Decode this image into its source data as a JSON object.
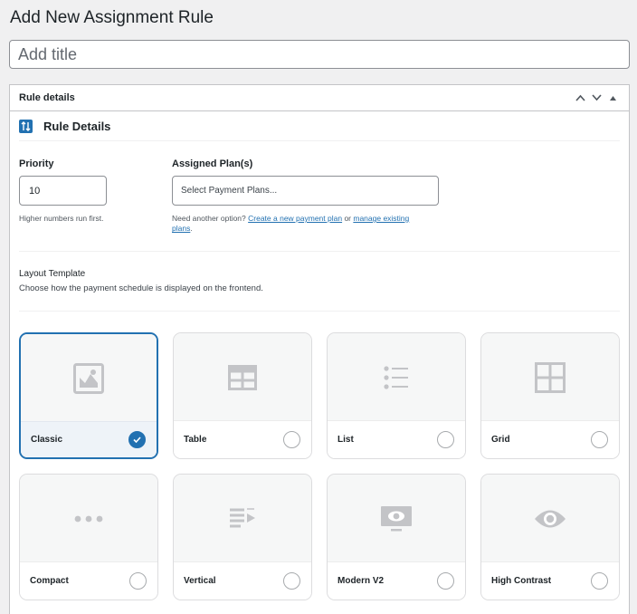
{
  "page": {
    "title": "Add New Assignment Rule"
  },
  "title_input": {
    "placeholder": "Add title",
    "value": ""
  },
  "postbox": {
    "title": "Rule details",
    "section_title": "Rule Details",
    "priority": {
      "label": "Priority",
      "value": "10",
      "help": "Higher numbers run first."
    },
    "plan": {
      "label": "Assigned Plan(s)",
      "placeholder": "Select Payment Plans...",
      "help_prefix": "Need another option? ",
      "create_link": "Create a new payment plan",
      "help_or": " or ",
      "manage_link": "manage existing plans",
      "help_suffix": "."
    },
    "layout": {
      "title": "Layout Template",
      "description": "Choose how the payment schedule is displayed on the frontend.",
      "options": [
        {
          "label": "Classic",
          "icon": "image-icon",
          "selected": true
        },
        {
          "label": "Table",
          "icon": "table-icon",
          "selected": false
        },
        {
          "label": "List",
          "icon": "list-icon",
          "selected": false
        },
        {
          "label": "Grid",
          "icon": "grid-icon",
          "selected": false
        },
        {
          "label": "Compact",
          "icon": "ellipsis-icon",
          "selected": false
        },
        {
          "label": "Vertical",
          "icon": "vertical-icon",
          "selected": false
        },
        {
          "label": "Modern V2",
          "icon": "monitor-icon",
          "selected": false
        },
        {
          "label": "High Contrast",
          "icon": "eye-icon",
          "selected": false
        }
      ]
    }
  },
  "colors": {
    "accent": "#2271b1",
    "background": "#f0f0f1",
    "icon_gray": "#c3c4c7"
  }
}
